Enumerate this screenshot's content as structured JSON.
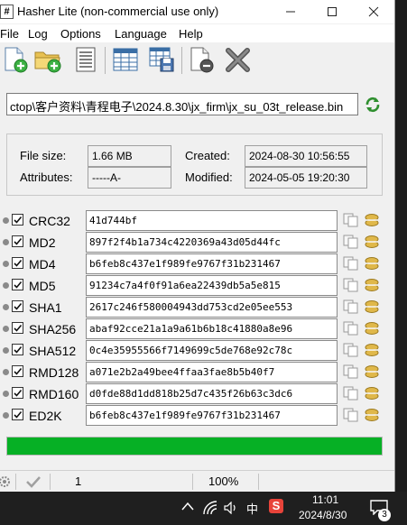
{
  "window": {
    "title": "Hasher Lite (non-commercial use only)",
    "icon_glyph": "#",
    "controls": [
      "minimize-icon",
      "maximize-icon",
      "close-icon"
    ]
  },
  "menu": [
    "File",
    "Log",
    "Options",
    "Language",
    "Help"
  ],
  "toolbar": [
    "new-file-icon",
    "open-folder-icon",
    "text-document-icon",
    "table-icon",
    "save-table-icon",
    "remove-document-icon",
    "cross-icon"
  ],
  "path": {
    "value": "ctop\\客户资料\\青程电子\\2024.8.30\\jx_firm\\jx_su_03t_release.bin"
  },
  "info": {
    "file_size_label": "File size:",
    "file_size": "1.66 MB",
    "attributes_label": "Attributes:",
    "attributes": "-----A-",
    "created_label": "Created:",
    "created": "2024-08-30 10:56:55",
    "modified_label": "Modified:",
    "modified": "2024-05-05 19:20:30"
  },
  "hashes": [
    {
      "name": "CRC32",
      "value": "41d744bf",
      "checked": true
    },
    {
      "name": "MD2",
      "value": "897f2f4b1a734c4220369a43d05d44fc",
      "checked": true
    },
    {
      "name": "MD4",
      "value": "b6feb8c437e1f989fe9767f31b231467",
      "checked": true
    },
    {
      "name": "MD5",
      "value": "91234c7a4f0f91a6ea22439db5a5e815",
      "checked": true
    },
    {
      "name": "SHA1",
      "value": "2617c246f580004943dd753cd2e05ee553",
      "checked": true
    },
    {
      "name": "SHA256",
      "value": "abaf92cce21a1a9a61b6b18c41880a8e96",
      "checked": true
    },
    {
      "name": "SHA512",
      "value": "0c4e35955566f7149699c5de768e92c78c",
      "checked": true
    },
    {
      "name": "RMD128",
      "value": "a071e2b2a49bee4ffaa3fae8b5b40f7",
      "checked": true
    },
    {
      "name": "RMD160",
      "value": "d0fde88d1dd818b25d7c435f26b63c3dc6",
      "checked": true
    },
    {
      "name": "ED2K",
      "value": "b6feb8c437e1f989fe9767f31b231467",
      "checked": true
    }
  ],
  "progress": {
    "fraction": 1.0,
    "color": "#06b025"
  },
  "status": {
    "count": "1",
    "zoom": "100%"
  },
  "taskbar": {
    "ime": "中",
    "time": "11:01",
    "date": "2024/8/30",
    "notifications": "3"
  }
}
